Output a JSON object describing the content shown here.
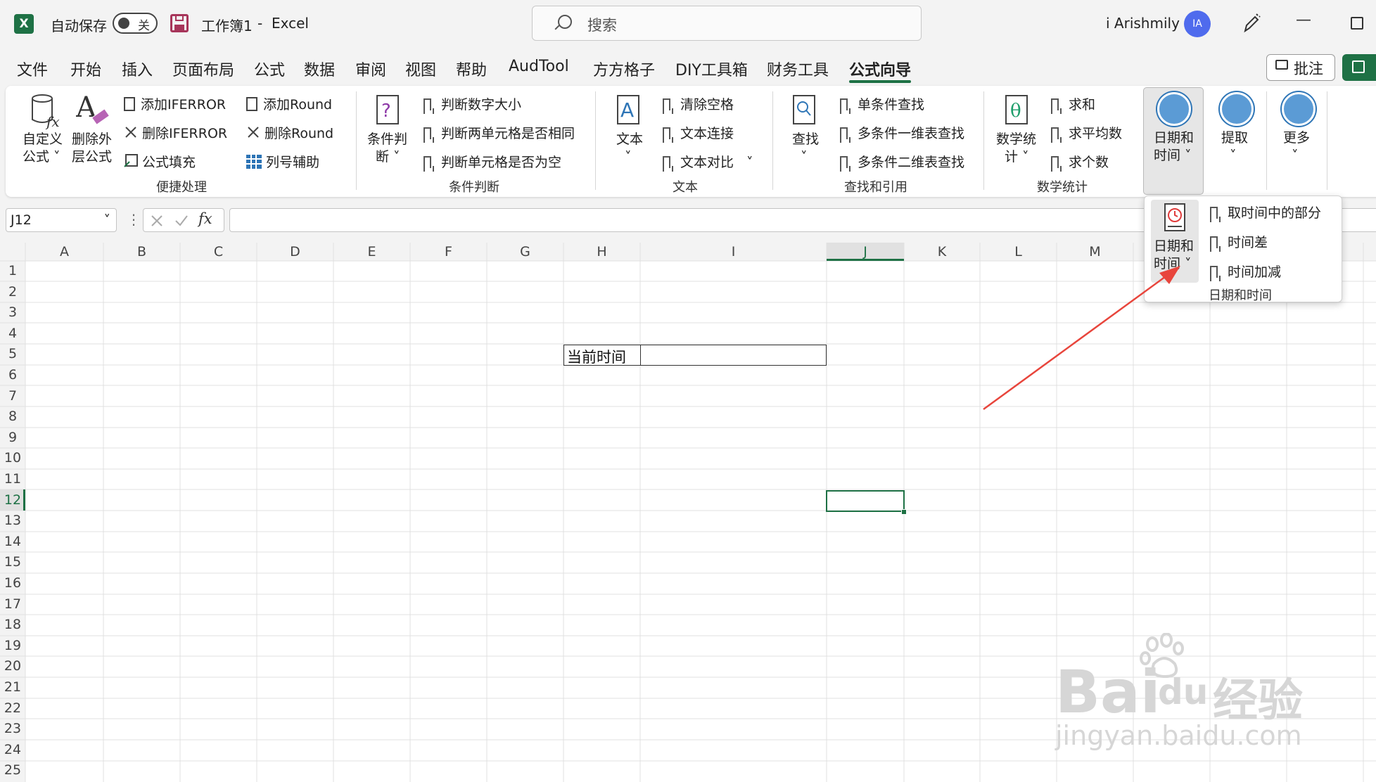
{
  "titlebar": {
    "autosave_label": "自动保存",
    "autosave_state": "关",
    "doc_title": "工作簿1",
    "separator": "-",
    "app_name": "Excel",
    "search_placeholder": "搜索",
    "user_name": "i Arishmily",
    "avatar_initials": "IA"
  },
  "menu": {
    "tabs": [
      "文件",
      "开始",
      "插入",
      "页面布局",
      "公式",
      "数据",
      "审阅",
      "视图",
      "帮助",
      "AudTool",
      "方方格子",
      "DIY工具箱",
      "财务工具",
      "公式向导"
    ],
    "active_tab": "公式向导",
    "comment_button": "批注"
  },
  "ribbon": {
    "quick": {
      "custom_formula": [
        "自定义",
        "公式"
      ],
      "remove_outer": [
        "删除外",
        "层公式"
      ],
      "add_iferror": "添加IFERROR",
      "remove_iferror": "删除IFERROR",
      "formula_fill": "公式填充",
      "add_round": "添加Round",
      "remove_round": "删除Round",
      "column_helper": "列号辅助",
      "group_label": "便捷处理"
    },
    "condition": {
      "big_label": [
        "条件判",
        "断"
      ],
      "items": [
        "判断数字大小",
        "判断两单元格是否相同",
        "判断单元格是否为空"
      ],
      "group_label": "条件判断"
    },
    "text": {
      "big_label": "文本",
      "items": [
        "清除空格",
        "文本连接",
        "文本对比"
      ],
      "group_label": "文本"
    },
    "lookup": {
      "big_label": "查找",
      "items": [
        "单条件查找",
        "多条件一维表查找",
        "多条件二维表查找"
      ],
      "group_label": "查找和引用"
    },
    "math": {
      "big_label": [
        "数学统",
        "计"
      ],
      "items": [
        "求和",
        "求平均数",
        "求个数"
      ],
      "group_label": "数学统计"
    },
    "datetime_button": [
      "日期和",
      "时间"
    ],
    "extract_button": "提取",
    "more_button": "更多"
  },
  "formula_bar": {
    "name_box": "J12",
    "fx": "fx",
    "content": ""
  },
  "grid": {
    "columns": [
      "A",
      "B",
      "C",
      "D",
      "E",
      "F",
      "G",
      "H",
      "I",
      "J",
      "K",
      "L",
      "M"
    ],
    "rows": [
      "1",
      "2",
      "3",
      "4",
      "5",
      "6",
      "7",
      "8",
      "9",
      "10",
      "11",
      "12",
      "13",
      "14",
      "15",
      "16",
      "17",
      "18",
      "19",
      "20",
      "21",
      "22",
      "23",
      "24",
      "25"
    ],
    "cell_H5": "当前时间",
    "selected_cell": "J12"
  },
  "popup": {
    "big_label": [
      "日期和",
      "时间"
    ],
    "items": [
      "取时间中的部分",
      "时间差",
      "时间加减"
    ],
    "group_label": "日期和时间"
  },
  "watermark": {
    "brand": "Bai",
    "brand2": "du",
    "cn": "经验",
    "url": "jingyan.baidu.com"
  },
  "colors": {
    "accent": "#1e7145",
    "selection": "#1e7145",
    "arrow": "#e8453c",
    "datetime_button": "#5b9bd5"
  }
}
